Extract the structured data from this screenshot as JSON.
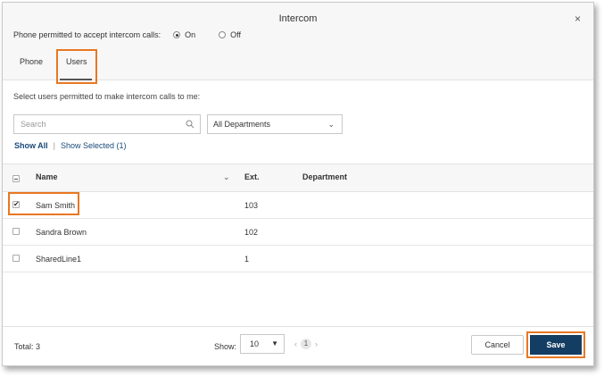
{
  "dialog": {
    "title": "Intercom",
    "close": "×"
  },
  "permission": {
    "label": "Phone permitted to accept intercom calls:",
    "on_label": "On",
    "off_label": "Off",
    "selected": "On"
  },
  "tabs": [
    {
      "label": "Phone",
      "active": false
    },
    {
      "label": "Users",
      "active": true
    }
  ],
  "instructions": "Select users permitted to make intercom calls to me:",
  "search": {
    "placeholder": "Search",
    "value": ""
  },
  "department_filter": {
    "selected": "All Departments"
  },
  "show_links": {
    "show_all": "Show All",
    "separator": "|",
    "show_selected": "Show Selected (1)"
  },
  "table": {
    "headers": {
      "name": "Name",
      "ext": "Ext.",
      "department": "Department"
    },
    "rows": [
      {
        "name": "Sam Smith",
        "ext": "103",
        "department": "",
        "checked": true
      },
      {
        "name": "Sandra Brown",
        "ext": "102",
        "department": "",
        "checked": false
      },
      {
        "name": "SharedLine1",
        "ext": "1",
        "department": "",
        "checked": false
      }
    ]
  },
  "footer": {
    "total": "Total: 3",
    "show_label": "Show:",
    "page_size": "10",
    "prev": "‹",
    "page": "1",
    "next": "›",
    "cancel": "Cancel",
    "save": "Save"
  },
  "colors": {
    "highlight": "#e87722",
    "save_bg": "#143d63",
    "link": "#1a4a7a"
  }
}
